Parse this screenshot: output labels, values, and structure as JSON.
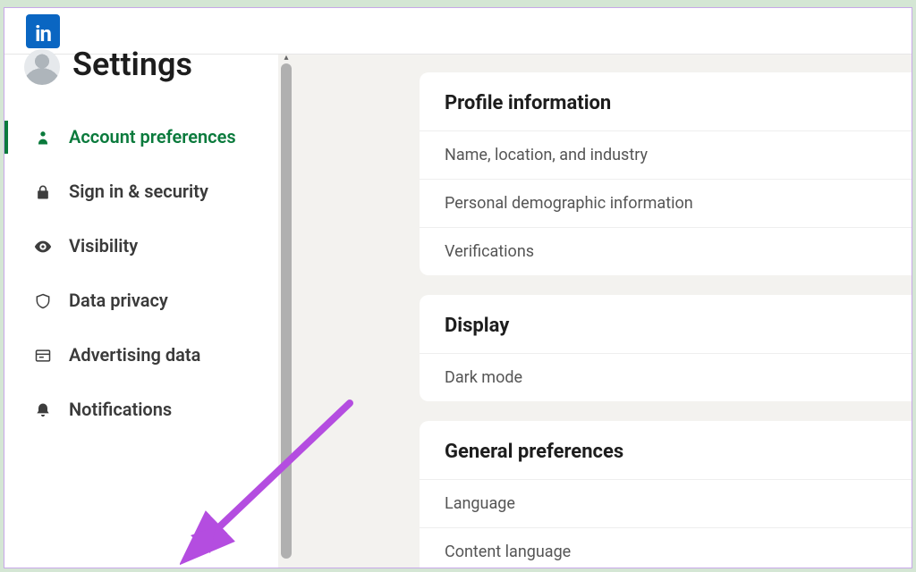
{
  "brand": {
    "logo_text": "in"
  },
  "page": {
    "title": "Settings"
  },
  "sidebar": {
    "items": [
      {
        "key": "account-preferences",
        "label": "Account preferences",
        "icon": "person-icon",
        "active": true
      },
      {
        "key": "sign-in-security",
        "label": "Sign in & security",
        "icon": "lock-icon",
        "active": false
      },
      {
        "key": "visibility",
        "label": "Visibility",
        "icon": "eye-icon",
        "active": false
      },
      {
        "key": "data-privacy",
        "label": "Data privacy",
        "icon": "shield-icon",
        "active": false
      },
      {
        "key": "advertising-data",
        "label": "Advertising data",
        "icon": "newspaper-icon",
        "active": false
      },
      {
        "key": "notifications",
        "label": "Notifications",
        "icon": "bell-icon",
        "active": false
      }
    ]
  },
  "sections": [
    {
      "key": "profile-information",
      "title": "Profile information",
      "rows": [
        {
          "label": "Name, location, and industry"
        },
        {
          "label": "Personal demographic information"
        },
        {
          "label": "Verifications"
        }
      ]
    },
    {
      "key": "display",
      "title": "Display",
      "rows": [
        {
          "label": "Dark mode"
        }
      ]
    },
    {
      "key": "general-preferences",
      "title": "General preferences",
      "rows": [
        {
          "label": "Language"
        },
        {
          "label": "Content language"
        }
      ]
    }
  ],
  "annotation": {
    "arrow_color": "#b44de0",
    "target": "notifications"
  }
}
